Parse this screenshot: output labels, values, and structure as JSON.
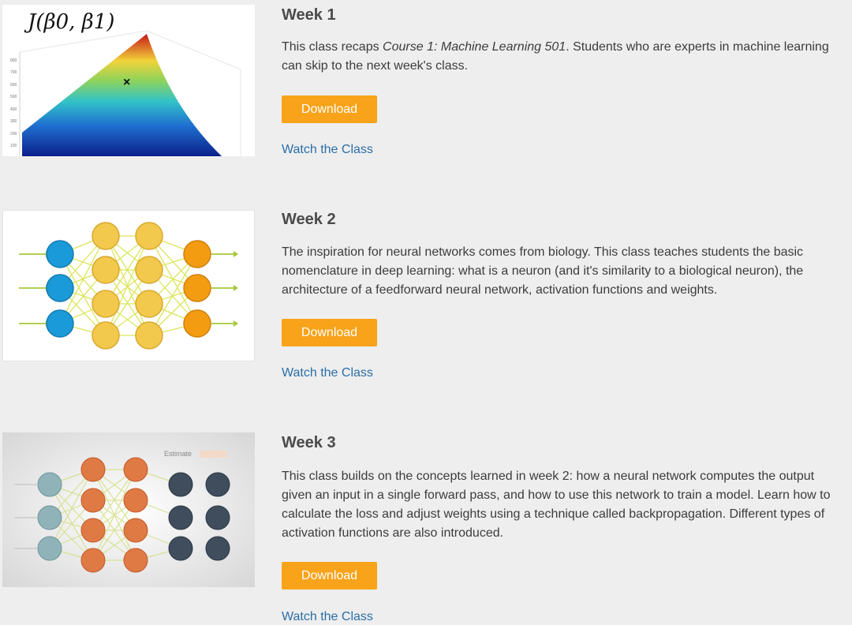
{
  "weeks": [
    {
      "title": "Week 1",
      "description_parts": {
        "before": "This class recaps ",
        "italic": "Course 1: Machine Learning 501",
        "after": ". Students who are experts in machine learning can skip to the next week's class."
      },
      "thumbnail_label": "J(β0, β1)",
      "download_label": "Download",
      "watch_label": "Watch the Class"
    },
    {
      "title": "Week 2",
      "description": "The inspiration for neural networks comes from biology. This class teaches students the basic nomenclature in deep learning: what is a neuron (and it's similarity to a biological neuron), the architecture of a feedforward neural network, activation functions and weights.",
      "download_label": "Download",
      "watch_label": "Watch the Class"
    },
    {
      "title": "Week 3",
      "description": "This class builds on the concepts learned in week 2: how a neural network computes the output given an input in a single forward pass, and how to use this network to train a model. Learn how to calculate the loss and adjust weights using a technique called backpropagation. Different types of activation functions are also introduced.",
      "thumbnail_label": "Estimate",
      "download_label": "Download",
      "watch_label": "Watch the Class"
    }
  ],
  "colors": {
    "background": "#eeeeee",
    "button": "#f9a31a",
    "link": "#2a6ea6",
    "input_neuron": "#1a9ad8",
    "hidden_neuron": "#f2c94c",
    "output_neuron": "#f39c12"
  }
}
